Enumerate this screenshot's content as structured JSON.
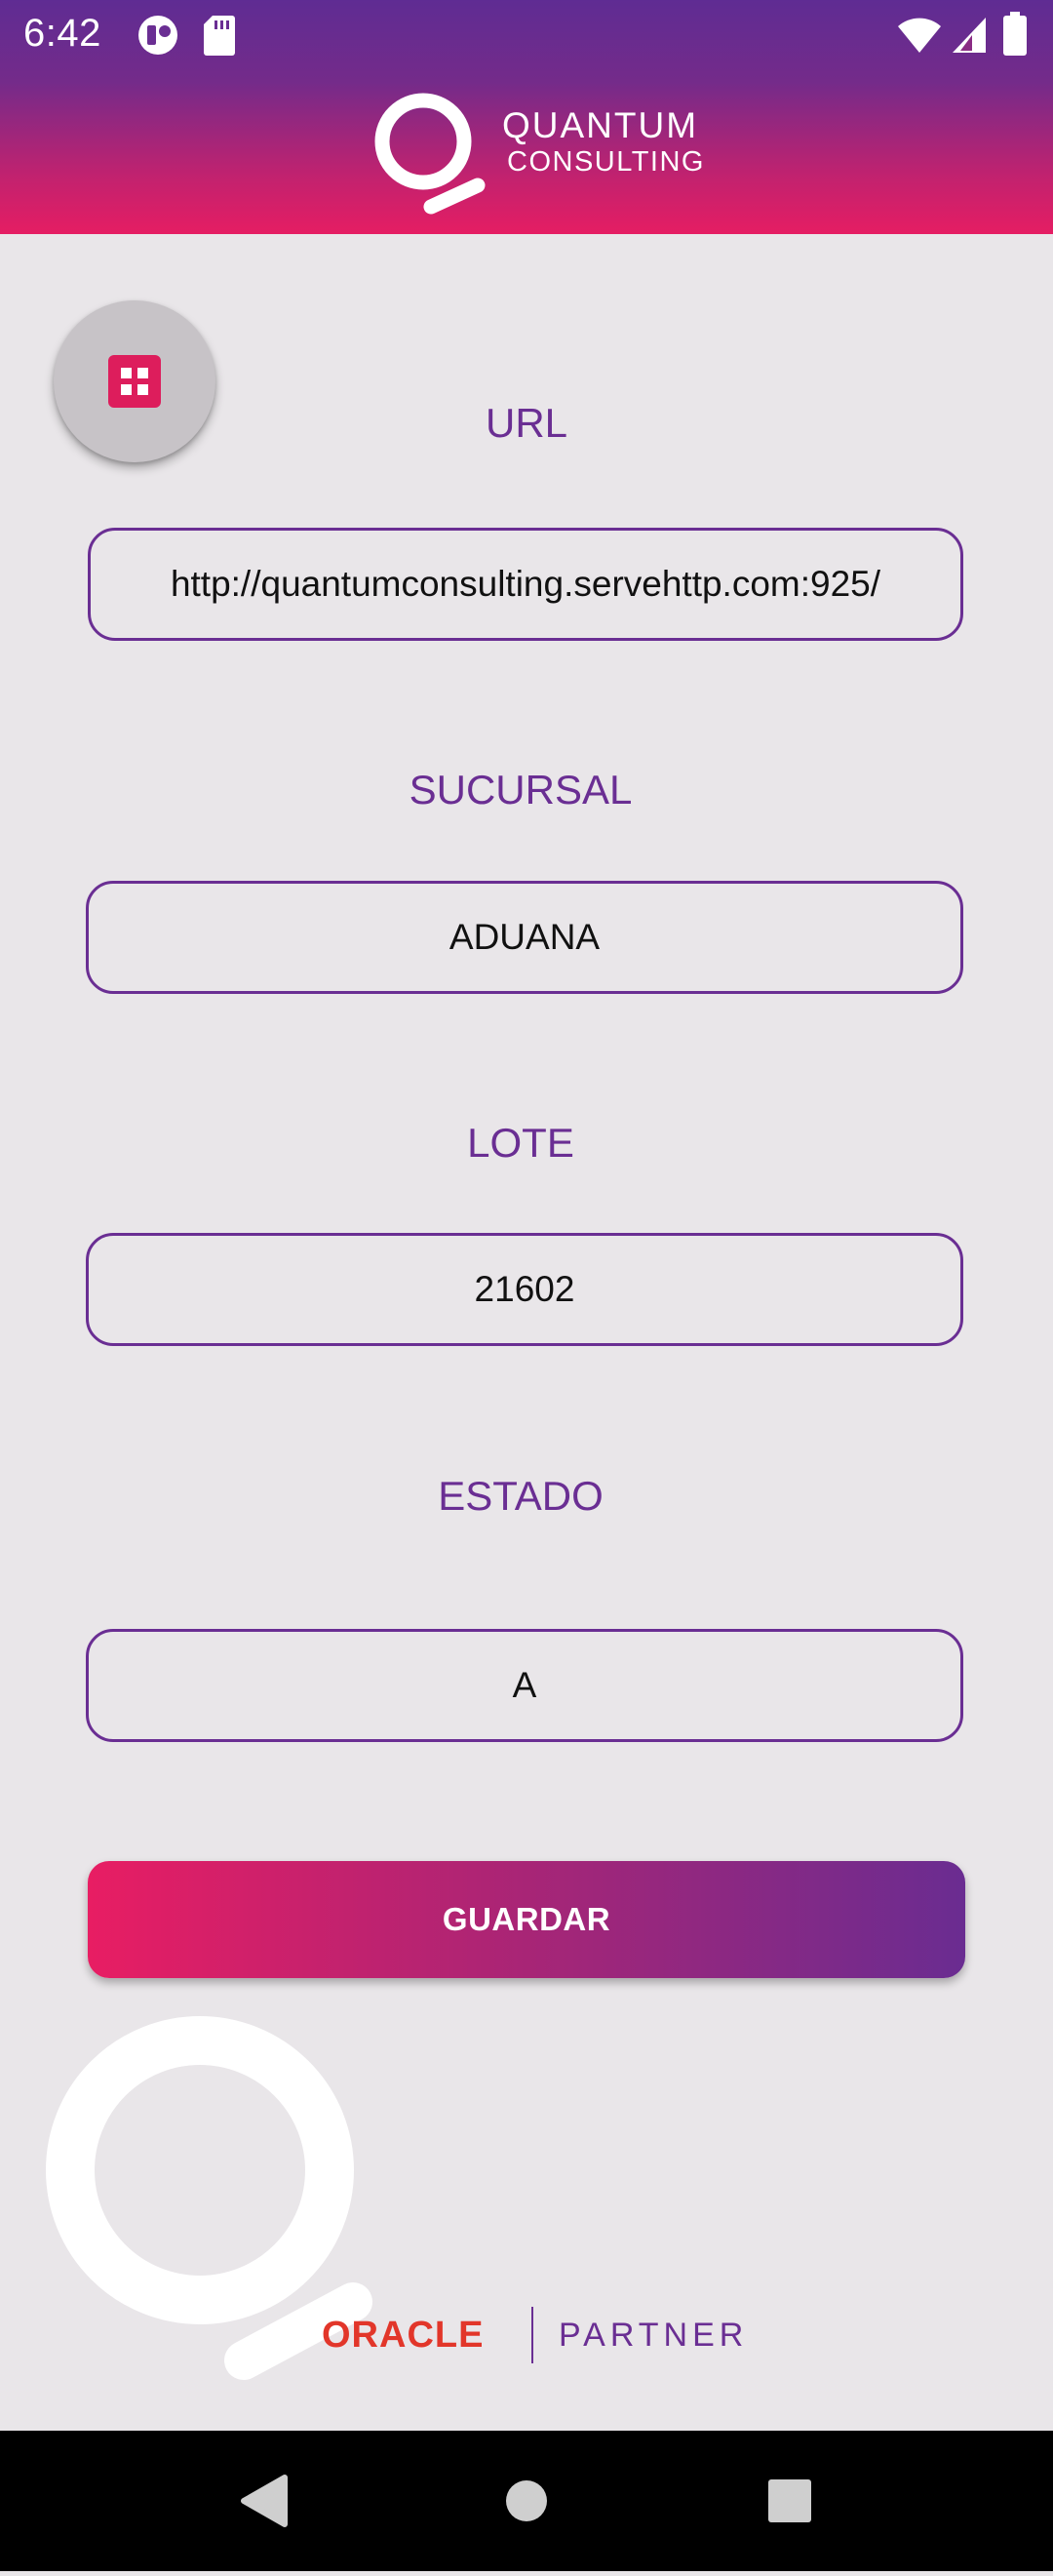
{
  "status_bar": {
    "time": "6:42",
    "icons": [
      "app-notification-icon",
      "sd-card-icon",
      "wifi-icon",
      "cell-signal-icon",
      "battery-icon"
    ]
  },
  "header": {
    "logo_line1": "QUANTUM",
    "logo_line2": "CONSULTING"
  },
  "fab": {
    "icon": "grid-menu-icon"
  },
  "form": {
    "url": {
      "label": "URL",
      "value": "http://quantumconsulting.servehttp.com:925/"
    },
    "sucursal": {
      "label": "SUCURSAL",
      "value": "ADUANA"
    },
    "lote": {
      "label": "LOTE",
      "value": "21602"
    },
    "estado": {
      "label": "ESTADO",
      "value": "A"
    },
    "save_label": "GUARDAR"
  },
  "footer": {
    "oracle": "ORACLE",
    "partner": "PARTNER"
  },
  "nav": {
    "icons": [
      "back-icon",
      "home-icon",
      "recents-icon"
    ]
  },
  "colors": {
    "accent_purple": "#6a2e93",
    "accent_pink": "#e51d63",
    "background": "#e9e6e9"
  }
}
